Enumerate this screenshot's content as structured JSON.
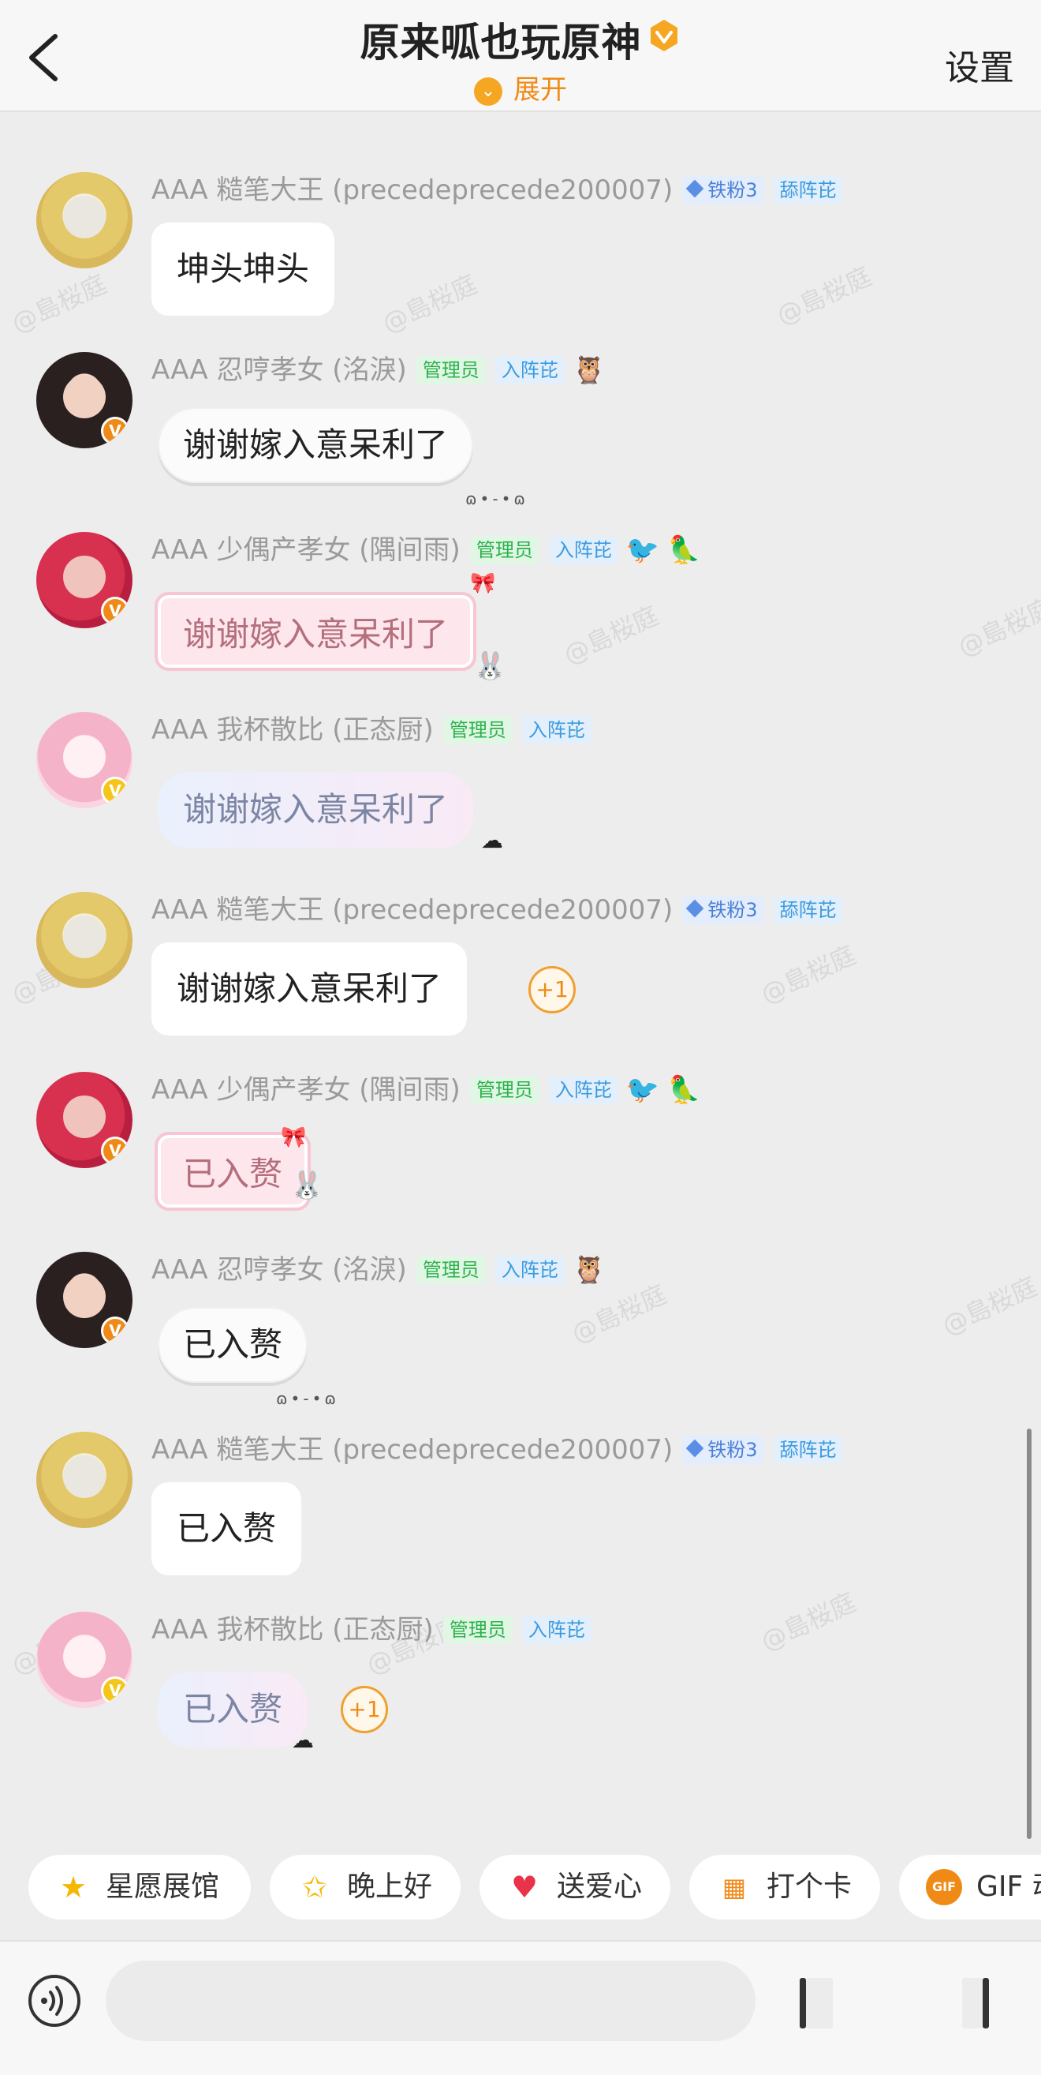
{
  "header": {
    "title": "原来呱也玩原神",
    "expand_label": "展开",
    "settings_label": "设置"
  },
  "messages": [
    {
      "name": "AAA 糙笔大王 (precedeprecede200007)",
      "tags": [
        "铁粉3",
        "舔阵芘"
      ],
      "text": "坤头坤头"
    },
    {
      "name": "AAA 忍哼孝女 (洺淚)",
      "tags": [
        "管理员",
        "入阵芘"
      ],
      "text": "谢谢嫁入意呆利了"
    },
    {
      "name": "AAA 少偶产孝女 (隅间雨)",
      "tags": [
        "管理员",
        "入阵芘"
      ],
      "text": "谢谢嫁入意呆利了"
    },
    {
      "name": "AAA 我杯散比 (正态厨)",
      "tags": [
        "管理员",
        "入阵芘"
      ],
      "text": "谢谢嫁入意呆利了"
    },
    {
      "name": "AAA 糙笔大王 (precedeprecede200007)",
      "tags": [
        "铁粉3",
        "舔阵芘"
      ],
      "text": "谢谢嫁入意呆利了",
      "reaction": "+1"
    },
    {
      "name": "AAA 少偶产孝女 (隅间雨)",
      "tags": [
        "管理员",
        "入阵芘"
      ],
      "text": "已入赘"
    },
    {
      "name": "AAA 忍哼孝女 (洺淚)",
      "tags": [
        "管理员",
        "入阵芘"
      ],
      "text": "已入赘"
    },
    {
      "name": "AAA 糙笔大王 (precedeprecede200007)",
      "tags": [
        "铁粉3",
        "舔阵芘"
      ],
      "text": "已入赘"
    },
    {
      "name": "AAA 我杯散比 (正态厨)",
      "tags": [
        "管理员",
        "入阵芘"
      ],
      "text": "已入赘",
      "reaction": "+1"
    }
  ],
  "watermark": "@島桜庭",
  "quick_actions": [
    {
      "label": "星愿展馆",
      "icon": "star-icon"
    },
    {
      "label": "晚上好",
      "icon": "moon-star-icon"
    },
    {
      "label": "送爱心",
      "icon": "heart-icon"
    },
    {
      "label": "打个卡",
      "icon": "calendar-icon"
    },
    {
      "label": "GIF 动",
      "icon": "gif-icon"
    }
  ],
  "input": {
    "placeholder": ""
  },
  "colors": {
    "accent": "#f08a17",
    "admin_tag": "#2bb34a",
    "blue_tag": "#3b9ae0",
    "background": "#ededed"
  }
}
